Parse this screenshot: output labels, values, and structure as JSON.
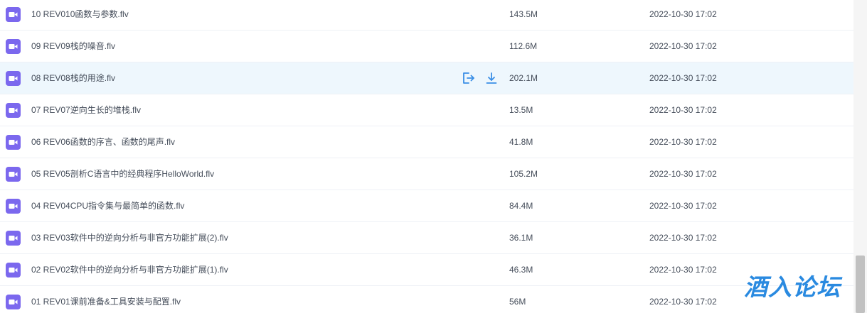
{
  "colors": {
    "accent": "#3a8ee6",
    "file_icon": "#7b68ee",
    "row_hover": "#eef7fd",
    "text": "#454d5a",
    "watermark": "#2a8ae0"
  },
  "files": [
    {
      "name": "10 REV010函数与参数.flv",
      "size": "143.5M",
      "date": "2022-10-30 17:02"
    },
    {
      "name": "09 REV09栈的噪音.flv",
      "size": "112.6M",
      "date": "2022-10-30 17:02"
    },
    {
      "name": "08 REV08栈的用途.flv",
      "size": "202.1M",
      "date": "2022-10-30 17:02",
      "hovered": true
    },
    {
      "name": "07 REV07逆向生长的堆栈.flv",
      "size": "13.5M",
      "date": "2022-10-30 17:02"
    },
    {
      "name": "06 REV06函数的序言、函数的尾声.flv",
      "size": "41.8M",
      "date": "2022-10-30 17:02"
    },
    {
      "name": "05 REV05剖析C语言中的经典程序HelloWorld.flv",
      "size": "105.2M",
      "date": "2022-10-30 17:02"
    },
    {
      "name": "04 REV04CPU指令集与最简单的函数.flv",
      "size": "84.4M",
      "date": "2022-10-30 17:02"
    },
    {
      "name": "03 REV03软件中的逆向分析与非官方功能扩展(2).flv",
      "size": "36.1M",
      "date": "2022-10-30 17:02"
    },
    {
      "name": "02 REV02软件中的逆向分析与非官方功能扩展(1).flv",
      "size": "46.3M",
      "date": "2022-10-30 17:02"
    },
    {
      "name": "01 REV01课前准备&工具安装与配置.flv",
      "size": "56M",
      "date": "2022-10-30 17:02"
    }
  ],
  "row_actions": {
    "share_icon": "share-icon",
    "download_icon": "download-icon"
  },
  "watermark": {
    "text": "酒入论坛"
  }
}
